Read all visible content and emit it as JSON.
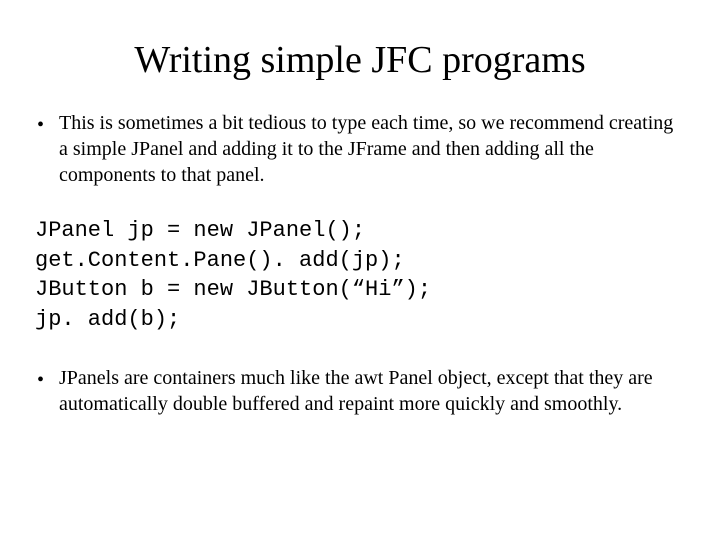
{
  "title": "Writing simple JFC programs",
  "bullets_top": [
    "This is sometimes a bit tedious to type each time, so we recommend creating a simple JPanel and adding it to the JFrame and then adding all the components to that panel."
  ],
  "code": [
    "JPanel jp = new JPanel();",
    "get.Content.Pane(). add(jp);",
    "JButton b = new JButton(“Hi”);",
    "jp. add(b);"
  ],
  "bullets_bottom": [
    "JPanels are containers much like the awt Panel object, except that they are automatically double buffered and repaint more quickly and smoothly."
  ]
}
